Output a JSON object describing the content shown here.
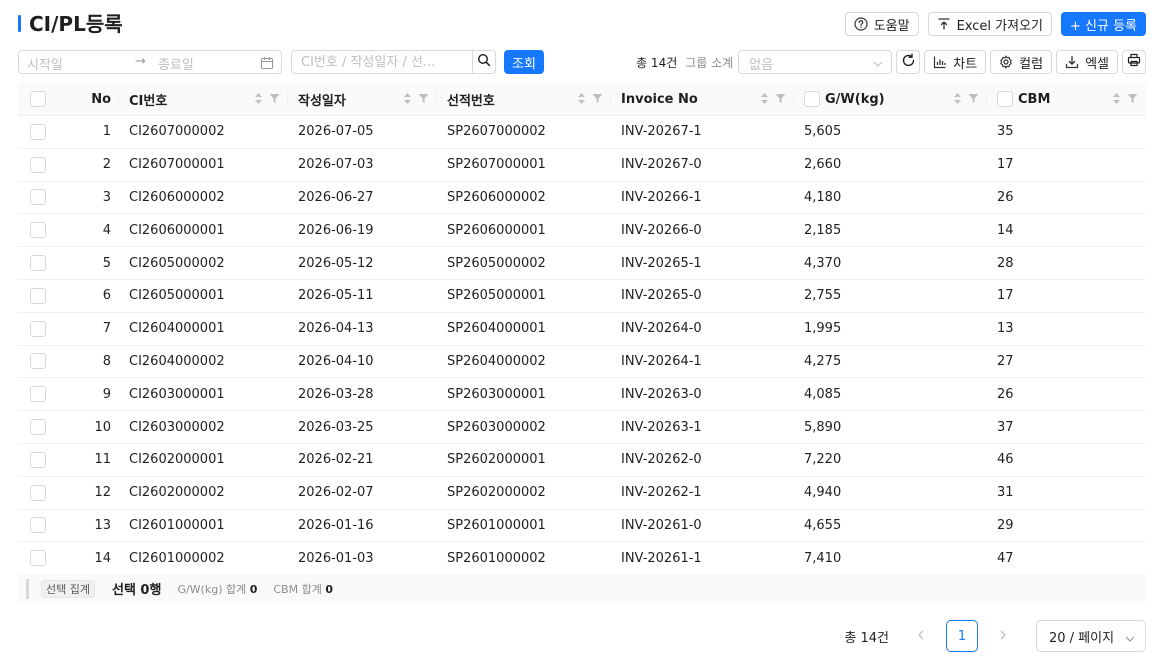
{
  "page": {
    "title": "CI/PL등록",
    "colors": {
      "accent": "#1677ff",
      "border": "#d9d9d9",
      "header_bg": "#fafafa"
    }
  },
  "header": {
    "help_label": "도움말",
    "excel_import_label": "Excel 가져오기",
    "new_label": "+ 신규 등록"
  },
  "filter": {
    "start_placeholder": "시작일",
    "end_placeholder": "종료일",
    "search_placeholder": "CI번호 / 작성일자 / 선...",
    "query_label": "조회"
  },
  "tools": {
    "total_text": "총 14건",
    "group_label": "그룹 소계",
    "group_value": "없음",
    "chart_label": "차트",
    "column_label": "컬럼",
    "excel_label": "엑셀"
  },
  "table": {
    "columns": {
      "no": "No",
      "ci": "CI번호",
      "date": "작성일자",
      "sp": "선적번호",
      "invoice": "Invoice No",
      "gw": "G/W(kg)",
      "cbm": "CBM"
    },
    "rows": [
      {
        "no": "1",
        "ci": "CI2607000002",
        "date": "2026-07-05",
        "sp": "SP2607000002",
        "invoice": "INV-20267-1",
        "gw": "5,605",
        "cbm": "35"
      },
      {
        "no": "2",
        "ci": "CI2607000001",
        "date": "2026-07-03",
        "sp": "SP2607000001",
        "invoice": "INV-20267-0",
        "gw": "2,660",
        "cbm": "17"
      },
      {
        "no": "3",
        "ci": "CI2606000002",
        "date": "2026-06-27",
        "sp": "SP2606000002",
        "invoice": "INV-20266-1",
        "gw": "4,180",
        "cbm": "26"
      },
      {
        "no": "4",
        "ci": "CI2606000001",
        "date": "2026-06-19",
        "sp": "SP2606000001",
        "invoice": "INV-20266-0",
        "gw": "2,185",
        "cbm": "14"
      },
      {
        "no": "5",
        "ci": "CI2605000002",
        "date": "2026-05-12",
        "sp": "SP2605000002",
        "invoice": "INV-20265-1",
        "gw": "4,370",
        "cbm": "28"
      },
      {
        "no": "6",
        "ci": "CI2605000001",
        "date": "2026-05-11",
        "sp": "SP2605000001",
        "invoice": "INV-20265-0",
        "gw": "2,755",
        "cbm": "17"
      },
      {
        "no": "7",
        "ci": "CI2604000001",
        "date": "2026-04-13",
        "sp": "SP2604000001",
        "invoice": "INV-20264-0",
        "gw": "1,995",
        "cbm": "13"
      },
      {
        "no": "8",
        "ci": "CI2604000002",
        "date": "2026-04-10",
        "sp": "SP2604000002",
        "invoice": "INV-20264-1",
        "gw": "4,275",
        "cbm": "27"
      },
      {
        "no": "9",
        "ci": "CI2603000001",
        "date": "2026-03-28",
        "sp": "SP2603000001",
        "invoice": "INV-20263-0",
        "gw": "4,085",
        "cbm": "26"
      },
      {
        "no": "10",
        "ci": "CI2603000002",
        "date": "2026-03-25",
        "sp": "SP2603000002",
        "invoice": "INV-20263-1",
        "gw": "5,890",
        "cbm": "37"
      },
      {
        "no": "11",
        "ci": "CI2602000001",
        "date": "2026-02-21",
        "sp": "SP2602000001",
        "invoice": "INV-20262-0",
        "gw": "7,220",
        "cbm": "46"
      },
      {
        "no": "12",
        "ci": "CI2602000002",
        "date": "2026-02-07",
        "sp": "SP2602000002",
        "invoice": "INV-20262-1",
        "gw": "4,940",
        "cbm": "31"
      },
      {
        "no": "13",
        "ci": "CI2601000001",
        "date": "2026-01-16",
        "sp": "SP2601000001",
        "invoice": "INV-20261-0",
        "gw": "4,655",
        "cbm": "29"
      },
      {
        "no": "14",
        "ci": "CI2601000002",
        "date": "2026-01-03",
        "sp": "SP2601000002",
        "invoice": "INV-20261-1",
        "gw": "7,410",
        "cbm": "47"
      }
    ]
  },
  "summary": {
    "tag": "선택 집계",
    "selected": "선택 0행",
    "gw_label": "G/W(kg) 합계",
    "gw_value": "0",
    "cbm_label": "CBM 합계",
    "cbm_value": "0"
  },
  "pagination": {
    "total": "총 14건",
    "current": "1",
    "page_size": "20 / 페이지"
  }
}
